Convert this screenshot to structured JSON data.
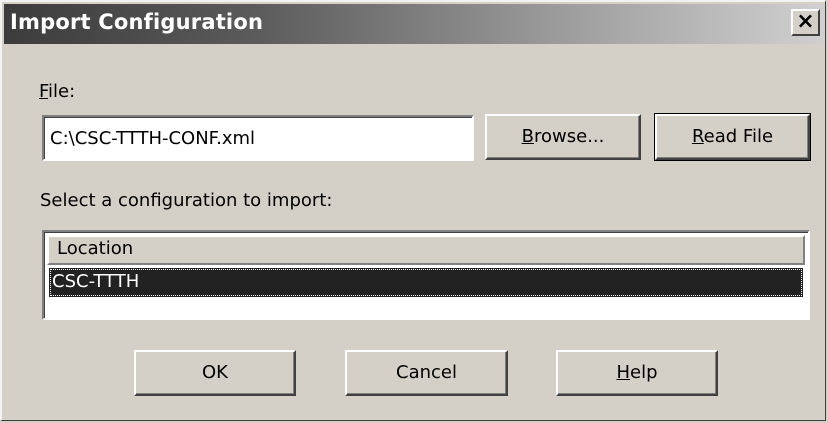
{
  "window": {
    "title": "Import Configuration",
    "close_glyph": "✕",
    "close_icon": "close-icon"
  },
  "file": {
    "label": "File:",
    "value": "C:\\CSC-TTTH-CONF.xml",
    "browse_label": "Browse...",
    "read_label": "Read File"
  },
  "selection": {
    "prompt": "Select a configuration to import:",
    "columns": [
      "Location"
    ],
    "rows": [
      {
        "location": "CSC-TTTH",
        "selected": true
      }
    ]
  },
  "buttons": {
    "ok": "OK",
    "cancel": "Cancel",
    "help": "Help"
  },
  "colors": {
    "dialog_bg": "#d4d0c8",
    "selection_bg": "#222222",
    "selection_fg": "#ffffff"
  }
}
